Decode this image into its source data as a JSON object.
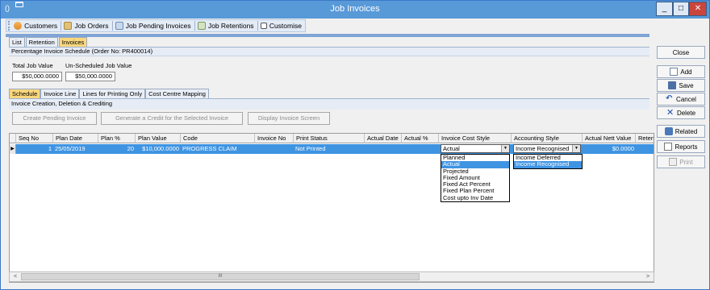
{
  "window": {
    "title": "Job Invoices",
    "minimize": "_",
    "maximize": "□",
    "close": "✕"
  },
  "toolbar": {
    "items": [
      "Customers",
      "Job Orders",
      "Job Pending Invoices",
      "Job Retentions",
      "Customise"
    ]
  },
  "outer_tabs": [
    "List",
    "Retention",
    "Invoices"
  ],
  "section_header": "Percentage Invoice Schedule (Order No: PR400014)",
  "totals": {
    "total_job_value_label": "Total Job Value",
    "total_job_value": "$50,000.0000",
    "unscheduled_label": "Un-Scheduled Job Value",
    "unscheduled_value": "$50,000.0000"
  },
  "inner_tabs": [
    "Schedule",
    "Invoice Line",
    "Lines for Printing Only",
    "Cost Centre Mapping"
  ],
  "inner_header": "Invoice Creation, Deletion & Crediting",
  "actions": {
    "create": "Create Pending Invoice",
    "credit": "Generate a Credit for the Selected Invoice",
    "display": "Display Invoice Screen"
  },
  "grid": {
    "columns": [
      "Seq No",
      "Plan Date",
      "Plan %",
      "Plan Value",
      "Code",
      "Invoice No",
      "Print Status",
      "Actual Date",
      "Actual %",
      "Invoice Cost Style",
      "Accounting Style",
      "Actual Nett Value",
      "Reten"
    ],
    "row": {
      "marker": "▶",
      "seq_no": "1",
      "plan_date": "25/05/2019",
      "plan_pct": "20",
      "plan_value": "$10,000.0000",
      "code": "PROGRESS CLAIM",
      "invoice_no": "",
      "print_status": "Not Printed",
      "actual_date": "",
      "actual_pct": "",
      "invoice_cost_style": "Actual",
      "accounting_style": "Income Recognised",
      "actual_nett_value": "$0.0000"
    },
    "cost_style_options": [
      "Planned",
      "Actual",
      "Projected",
      "Fixed Amount",
      "Fixed Act Percent",
      "Fixed Plan Percent",
      "Cost upto Inv Date"
    ],
    "cost_style_selected": "Actual",
    "accounting_options": [
      "Income Deferred",
      "Income Recognised"
    ],
    "accounting_selected": "Income Recognised"
  },
  "scrollbar": {
    "left": "<",
    "right": ">",
    "thumb": "III"
  },
  "right_buttons": {
    "close": "Close",
    "add": "Add",
    "save": "Save",
    "cancel": "Cancel",
    "delete": "Delete",
    "related": "Related",
    "reports": "Reports",
    "print": "Print"
  },
  "colors": {
    "titlebar": "#5899d8",
    "selection": "#3f94e2",
    "active_tab": "#f9d77e"
  }
}
